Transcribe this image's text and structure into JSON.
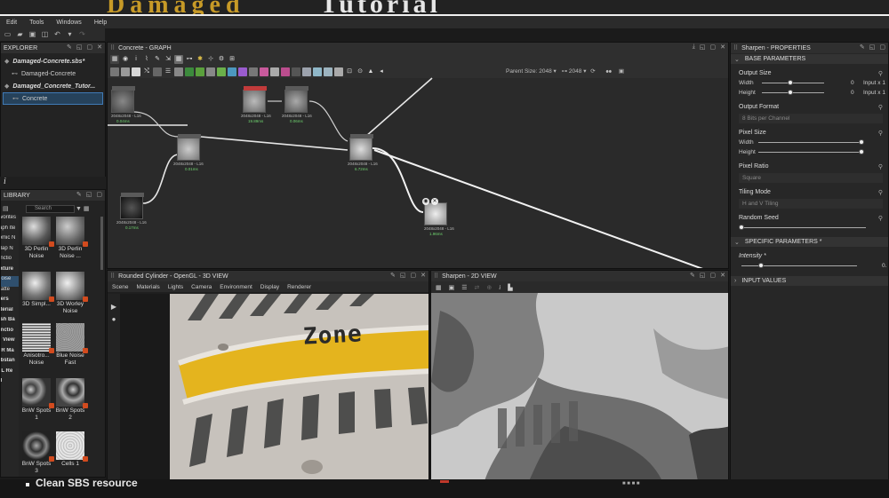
{
  "menu": [
    "Edit",
    "Tools",
    "Windows",
    "Help"
  ],
  "explorer": {
    "title": "EXPLORER",
    "items": [
      {
        "label": "Damaged-Concrete.sbs*",
        "style": "package"
      },
      {
        "label": "Damaged-Concrete",
        "style": "graph"
      },
      {
        "label": "Damaged_Concrete_Tutor...",
        "style": "package"
      },
      {
        "label": "Concrete",
        "style": "graph-selected"
      }
    ]
  },
  "library": {
    "title": "LIBRARY",
    "search_placeholder": "Search",
    "categories": [
      "avorites",
      "raph Ite",
      "tomic N",
      "Map N",
      "unctio",
      "exture",
      "Noise",
      "Patte",
      "lters",
      "aterial",
      "esh Ba",
      "unctio",
      "D View",
      "BR Ma",
      "ubstan",
      "DL Re",
      "dl"
    ],
    "tiles": [
      {
        "label": "3D Perlin Noise"
      },
      {
        "label": "3D Perlin Noise ..."
      },
      {
        "label": "3D Simpl..."
      },
      {
        "label": "3D Worley Noise"
      },
      {
        "label": "Anisotro... Noise"
      },
      {
        "label": "Blue Noise Fast"
      },
      {
        "label": "BnW Spots 1"
      },
      {
        "label": "BnW Spots 2"
      },
      {
        "label": "BnW Spots 3"
      },
      {
        "label": "Cells 1"
      }
    ]
  },
  "graph": {
    "title": "Concrete - GRAPH",
    "parent_size_label": "Parent Size:",
    "parent_size_value": "2048",
    "size_value": "2048"
  },
  "properties": {
    "title": "Sharpen - PROPERTIES",
    "base_section": "BASE PARAMETERS",
    "output_size": {
      "label": "Output Size",
      "width_label": "Width",
      "height_label": "Height",
      "width_value": "0",
      "height_value": "0",
      "width_mode": "Input x 1",
      "height_mode": "Input x 1"
    },
    "output_format": {
      "label": "Output Format",
      "value": "8 Bits per Channel"
    },
    "pixel_size": {
      "label": "Pixel Size",
      "width_label": "Width",
      "height_label": "Height"
    },
    "pixel_ratio": {
      "label": "Pixel Ratio",
      "value": "Square"
    },
    "tiling_mode": {
      "label": "Tiling Mode",
      "value": "H and V Tiling"
    },
    "random_seed": {
      "label": "Random Seed"
    },
    "specific_section": "SPECIFIC PARAMETERS *",
    "intensity": {
      "label": "Intensity *",
      "value": "0.",
      "level": 0.17
    },
    "input_section": "INPUT VALUES"
  },
  "view3d": {
    "title": "Rounded Cylinder - OpenGL - 3D VIEW",
    "menu": [
      "Scene",
      "Materials",
      "Lights",
      "Camera",
      "Environment",
      "Display",
      "Renderer"
    ],
    "stencil_text": "Zone"
  },
  "view2d": {
    "title": "Sharpen - 2D VIEW"
  },
  "overlay": {
    "bottom_caption": "Clean SBS resource"
  }
}
